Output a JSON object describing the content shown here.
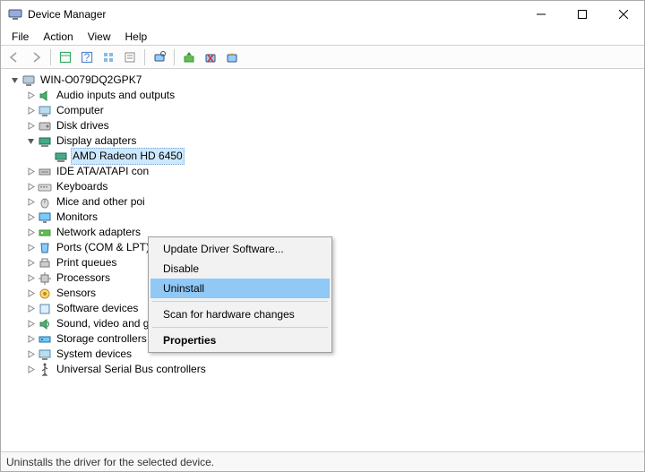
{
  "window": {
    "title": "Device Manager"
  },
  "menubar": {
    "file": "File",
    "action": "Action",
    "view": "View",
    "help": "Help"
  },
  "tree": {
    "root": "WIN-O079DQ2GPK7",
    "items": {
      "audio": "Audio inputs and outputs",
      "computer": "Computer",
      "disk": "Disk drives",
      "display": "Display adapters",
      "display_child": "AMD Radeon HD 6450",
      "ide": "IDE ATA/ATAPI con",
      "keyboards": "Keyboards",
      "mice": "Mice and other poi",
      "monitors": "Monitors",
      "network": "Network adapters",
      "ports": "Ports (COM & LPT)",
      "printq": "Print queues",
      "processors": "Processors",
      "sensors": "Sensors",
      "software": "Software devices",
      "sound": "Sound, video and game controllers",
      "storage": "Storage controllers",
      "system": "System devices",
      "usb": "Universal Serial Bus controllers"
    }
  },
  "context_menu": {
    "update": "Update Driver Software...",
    "disable": "Disable",
    "uninstall": "Uninstall",
    "scan": "Scan for hardware changes",
    "properties": "Properties"
  },
  "statusbar": {
    "text": "Uninstalls the driver for the selected device."
  }
}
